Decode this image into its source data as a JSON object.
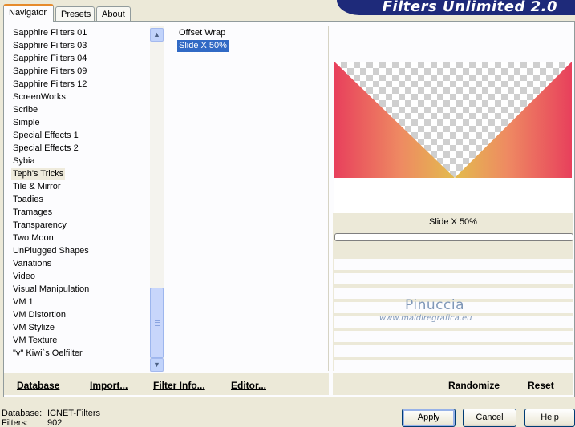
{
  "tabs": [
    {
      "label": "Navigator",
      "active": true
    },
    {
      "label": "Presets",
      "active": false
    },
    {
      "label": "About",
      "active": false
    }
  ],
  "banner": {
    "title": "Filters Unlimited 2.0"
  },
  "categories": [
    "Sapphire Filters 01",
    "Sapphire Filters 03",
    "Sapphire Filters 04",
    "Sapphire Filters 09",
    "Sapphire Filters 12",
    "ScreenWorks",
    "Scribe",
    "Simple",
    "Special Effects 1",
    "Special Effects 2",
    "Sybia",
    "Teph's Tricks",
    "Tile & Mirror",
    "Toadies",
    "Tramages",
    "Transparency",
    "Two Moon",
    "UnPlugged Shapes",
    "Variations",
    "Video",
    "Visual Manipulation",
    "VM 1",
    "VM Distortion",
    "VM Stylize",
    "VM Texture",
    "\"v\" Kiwi`s Oelfilter"
  ],
  "selected_category": "Teph's Tricks",
  "filters": [
    "Offset Wrap",
    "Slide X 50%"
  ],
  "selected_filter": "Slide X 50%",
  "parameter": {
    "label": "Slide X 50%"
  },
  "watermark": {
    "name": "Pinuccia",
    "url": "www.maidiregrafica.eu"
  },
  "left_buttons": {
    "database": "Database",
    "import": "Import...",
    "filter_info": "Filter Info...",
    "editor": "Editor..."
  },
  "right_buttons": {
    "randomize": "Randomize",
    "reset": "Reset"
  },
  "status": {
    "database_label": "Database:",
    "database_value": "ICNET-Filters",
    "filters_label": "Filters:",
    "filters_value": "902"
  },
  "dialog_buttons": {
    "apply": "Apply",
    "cancel": "Cancel",
    "help": "Help"
  },
  "colors": {
    "selection": "#316ac5",
    "banner": "#1e2a7a",
    "face": "#ece9d8"
  },
  "icons": {
    "scroll_up": "arrow-up-icon",
    "scroll_down": "arrow-down-icon"
  }
}
